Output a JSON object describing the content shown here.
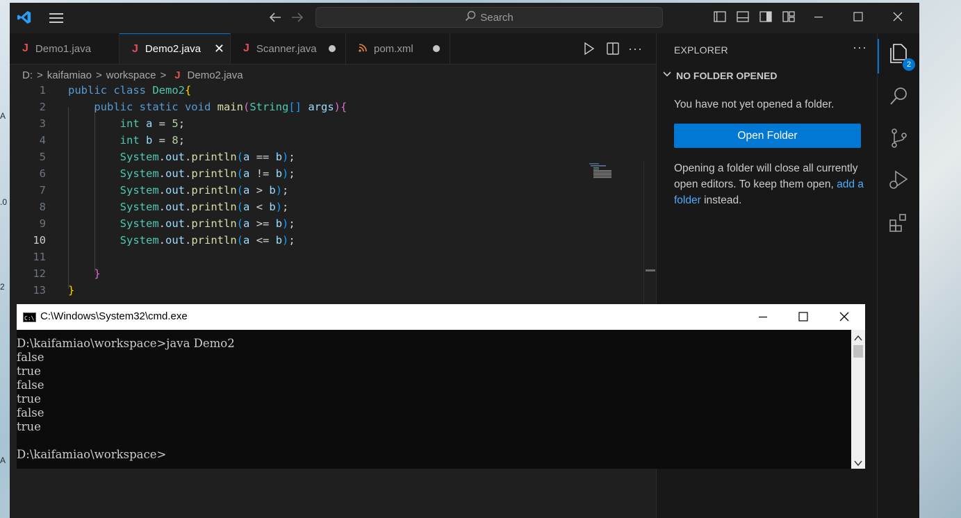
{
  "desktop": {
    "edge_labels": [
      "A",
      ".0",
      "2",
      "A"
    ]
  },
  "vscode": {
    "search": {
      "label": "Search"
    },
    "tabs": [
      {
        "label": "Demo1.java",
        "icon": "java-icon",
        "state": "clean"
      },
      {
        "label": "Demo2.java",
        "icon": "java-icon",
        "state": "active"
      },
      {
        "label": "Scanner.java",
        "icon": "java-icon",
        "state": "modified"
      },
      {
        "label": "pom.xml",
        "icon": "rss-icon",
        "state": "modified"
      }
    ],
    "breadcrumb": {
      "drive": "D:",
      "folder1": "kaifamiao",
      "folder2": "workspace",
      "file": "Demo2.java",
      "sep": ">"
    },
    "editor": {
      "line_numbers": [
        "1",
        "2",
        "3",
        "4",
        "5",
        "6",
        "7",
        "8",
        "9",
        "10",
        "11",
        "12",
        "13"
      ],
      "current_line": "10"
    },
    "explorer": {
      "title": "EXPLORER",
      "more": "···",
      "section": "NO FOLDER OPENED",
      "message": "You have not yet opened a folder.",
      "button": "Open Folder",
      "note_before": "Opening a folder will close all currently open editors. To keep them open, ",
      "note_link": "add a folder",
      "note_after": " instead."
    },
    "activity": {
      "explorer_badge": "2"
    },
    "colors": {
      "accent": "#0078d4",
      "background": "#1f1f1f",
      "sidebar": "#181818"
    }
  },
  "cmd": {
    "title": "C:\\Windows\\System32\\cmd.exe",
    "lines": [
      "",
      "D:\\kaifamiao\\workspace>java Demo2",
      "false",
      "true",
      "false",
      "true",
      "false",
      "true",
      "",
      "D:\\kaifamiao\\workspace>"
    ]
  }
}
